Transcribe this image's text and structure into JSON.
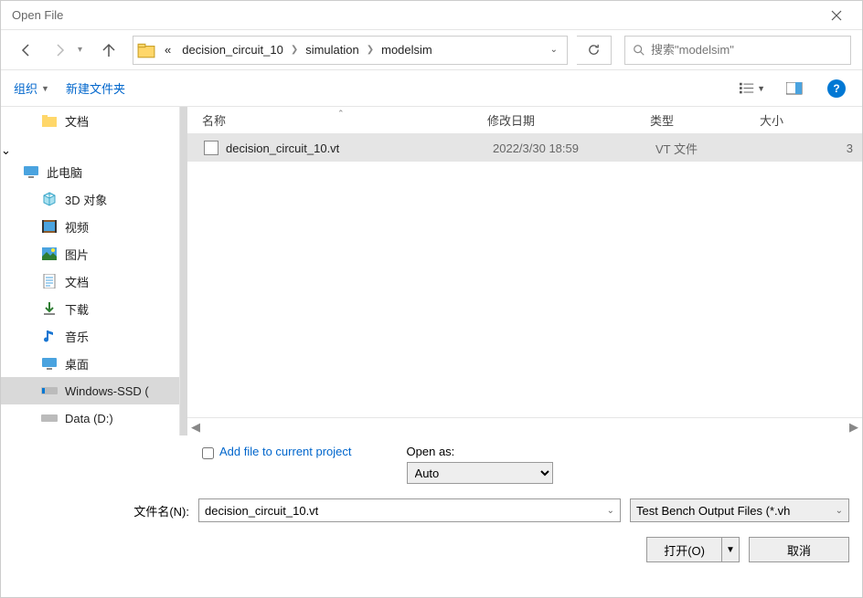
{
  "title": "Open File",
  "breadcrumb": {
    "prefix": "«",
    "items": [
      "decision_circuit_10",
      "simulation",
      "modelsim"
    ]
  },
  "search": {
    "placeholder": "搜索\"modelsim\""
  },
  "toolbar": {
    "organize": "组织",
    "newfolder": "新建文件夹"
  },
  "sidebar": {
    "docs": "文档",
    "thispc": "此电脑",
    "items": [
      "3D 对象",
      "视频",
      "图片",
      "文档",
      "下载",
      "音乐",
      "桌面",
      "Windows-SSD (",
      "Data (D:)"
    ]
  },
  "columns": {
    "name": "名称",
    "date": "修改日期",
    "type": "类型",
    "size": "大小"
  },
  "files": [
    {
      "name": "decision_circuit_10.vt",
      "date": "2022/3/30 18:59",
      "type": "VT 文件",
      "size": "3"
    }
  ],
  "options": {
    "addfile": "Add file to current project",
    "openas_label": "Open as:",
    "openas_value": "Auto"
  },
  "filename": {
    "label": "文件名(N):",
    "value": "decision_circuit_10.vt",
    "filter": "Test Bench Output Files (*.vh"
  },
  "buttons": {
    "open": "打开(O)",
    "cancel": "取消"
  }
}
